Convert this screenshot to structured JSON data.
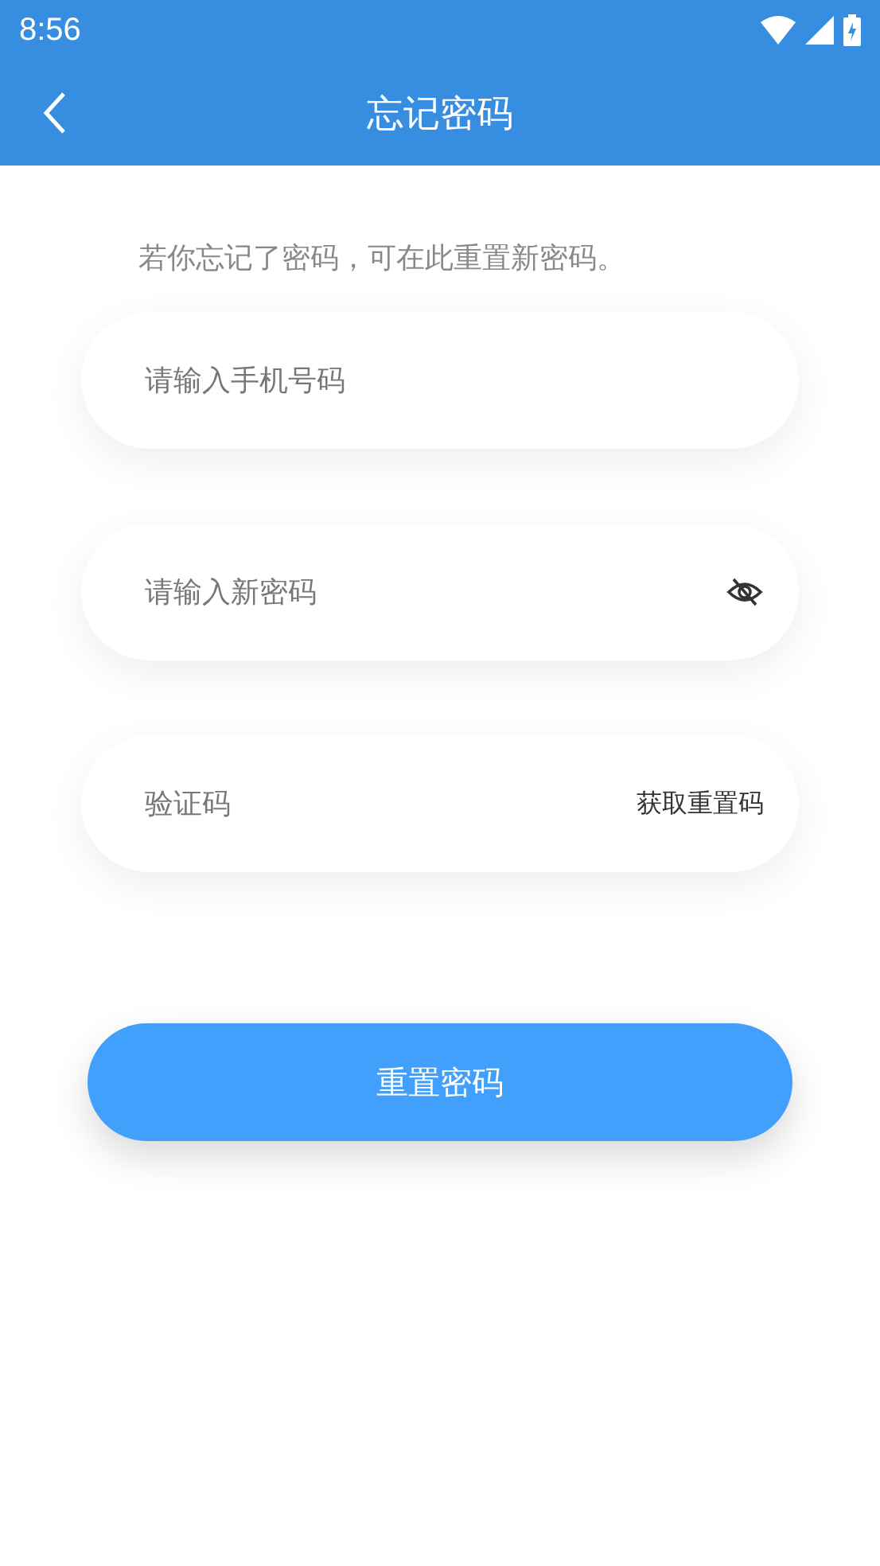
{
  "status_bar": {
    "time": "8:56"
  },
  "header": {
    "title": "忘记密码"
  },
  "hint": "若你忘记了密码，可在此重置新密码。",
  "fields": [
    {
      "kind": "plain",
      "placeholder": "请输入手机号码"
    },
    {
      "kind": "password",
      "placeholder": "请输入新密码"
    },
    {
      "kind": "code",
      "placeholder": "验证码",
      "action": "获取重置码"
    }
  ],
  "submit": "重置密码"
}
